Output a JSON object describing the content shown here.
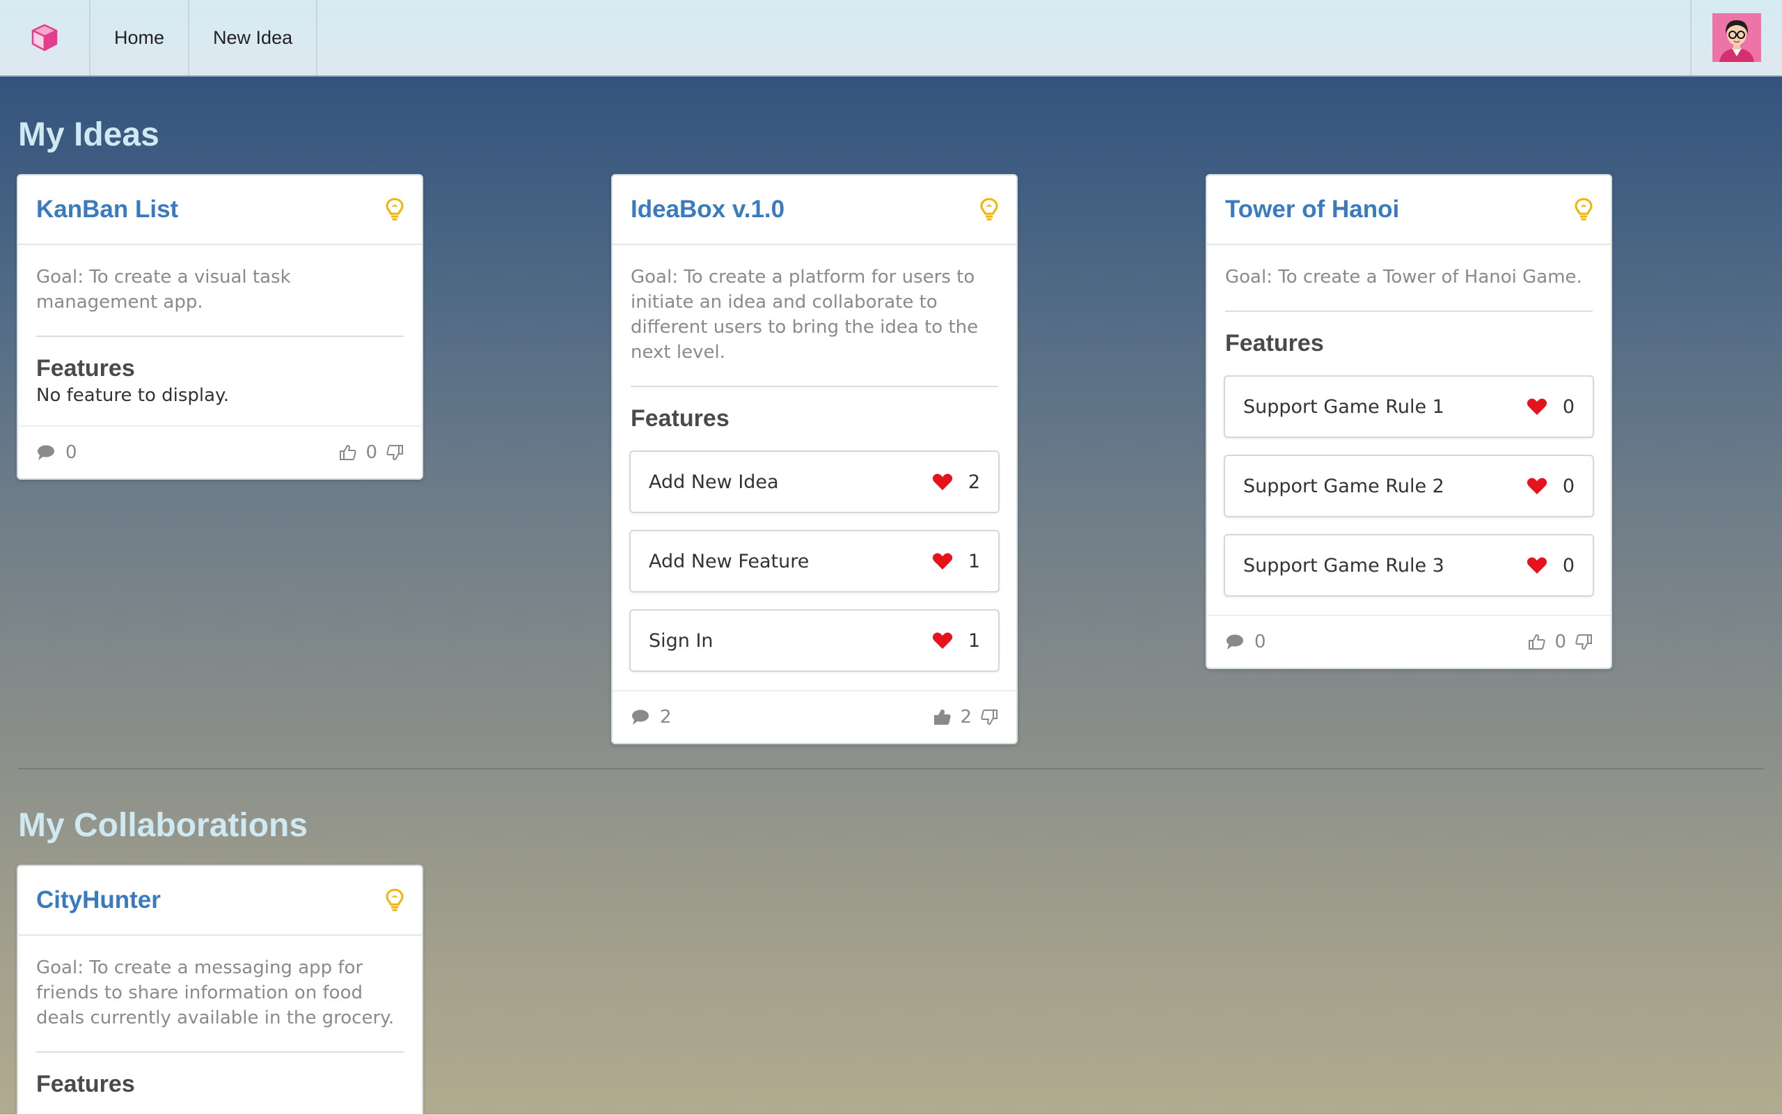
{
  "nav": {
    "logo_icon": "cube-icon",
    "items": [
      {
        "label": "Home"
      },
      {
        "label": "New Idea"
      }
    ],
    "avatar_icon": "user-avatar"
  },
  "sections": {
    "my_ideas": "My Ideas",
    "my_collaborations": "My Collaborations"
  },
  "colors": {
    "title_blue": "#3a7bbf",
    "bulb_yellow": "#f2b400",
    "heart_red": "#e8121c",
    "section_title": "#cfe9f3"
  },
  "labels": {
    "features": "Features"
  },
  "ideas": [
    {
      "title": "KanBan List",
      "goal": "Goal: To create a visual task management app.",
      "no_feature": "No feature to display.",
      "features": [],
      "comments": "0",
      "votes": "0"
    },
    {
      "title": "IdeaBox v.1.0",
      "goal": "Goal: To create a platform for users to initiate an idea and collaborate to different users to bring the idea to the next level.",
      "features": [
        {
          "name": "Add New Idea",
          "likes": "2"
        },
        {
          "name": "Add New Feature",
          "likes": "1"
        },
        {
          "name": "Sign In",
          "likes": "1"
        }
      ],
      "comments": "2",
      "votes": "2"
    },
    {
      "title": "Tower of Hanoi",
      "goal": "Goal: To create a Tower of Hanoi Game.",
      "features": [
        {
          "name": "Support Game Rule 1",
          "likes": "0"
        },
        {
          "name": "Support Game Rule 2",
          "likes": "0"
        },
        {
          "name": "Support Game Rule 3",
          "likes": "0"
        }
      ],
      "comments": "0",
      "votes": "0"
    }
  ],
  "collaborations": [
    {
      "title": "CityHunter",
      "goal": "Goal: To create a messaging app for friends to share information on food deals currently available in the grocery."
    }
  ]
}
